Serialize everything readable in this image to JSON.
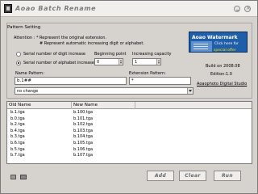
{
  "window": {
    "title": "Aoao Batch Rename"
  },
  "pattern": {
    "group_label": "Pattern Setting",
    "attention": "Attention : * Represent the original extension.",
    "attention2": "# Represent automatic increasing digit or alphabet.",
    "radio_digit": "Serial number of digit increase",
    "radio_alpha": "Serial number of alphabet increase",
    "radio_selected": "alphabet",
    "beginning_point_label": "Beginning point",
    "beginning_point_value": "0",
    "increasing_capacity_label": "Increasing capacity",
    "increasing_capacity_value": "1",
    "name_pattern_label": "Name Pattern:",
    "name_pattern_value": "b.1##",
    "extension_pattern_label": "Extension Pattern:",
    "extension_pattern_value": "*",
    "case_option": "no change"
  },
  "banner": {
    "title": "Aoao Watermark",
    "subtitle": "Click here for",
    "offer": "special offer"
  },
  "info": {
    "build": "Build on 2008.08",
    "edition": "Edition:1.0",
    "company": "Aoaophoto Digital Studio"
  },
  "list": {
    "col_old": "Old Name",
    "col_new": "New Name",
    "rows": [
      {
        "old": "b.1.tga",
        "new": "b.100.tga"
      },
      {
        "old": "b.0.tga",
        "new": "b.101.tga"
      },
      {
        "old": "b.2.tga",
        "new": "b.102.tga"
      },
      {
        "old": "b.4.tga",
        "new": "b.103.tga"
      },
      {
        "old": "b.3.tga",
        "new": "b.104.tga"
      },
      {
        "old": "b.6.tga",
        "new": "b.105.tga"
      },
      {
        "old": "b.5.tga",
        "new": "b.106.tga"
      },
      {
        "old": "b.7.tga",
        "new": "b.107.tga"
      }
    ]
  },
  "buttons": {
    "add": "Add",
    "clear": "Clear",
    "run": "Run"
  },
  "colors": {
    "banner_bg": "#1f5ea8",
    "offer": "#ffe000"
  },
  "icons": {
    "app": "app-icon",
    "tray_left": "settings-icon",
    "tray_right": "mail-icon"
  }
}
